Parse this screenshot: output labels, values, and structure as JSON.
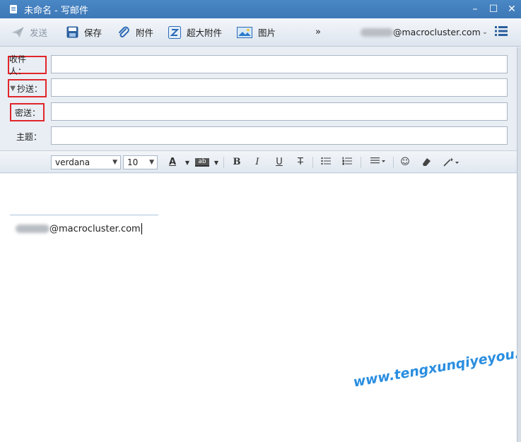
{
  "window": {
    "title": "未命名 - 写邮件",
    "controls": [
      "–",
      "☐",
      "✕"
    ]
  },
  "toolbar": {
    "send_label": "发送",
    "save_label": "保存",
    "attach_label": "附件",
    "big_attach_label": "超大附件",
    "picture_label": "图片",
    "more_label": "»",
    "account_suffix": "@macrocluster.com",
    "account_caret": "⌄"
  },
  "fields": {
    "to_label": "收件人：",
    "cc_label": "抄送：",
    "cc_toggle": "▼",
    "bcc_label": "密送：",
    "subject_label": "主题：",
    "to_value": "",
    "cc_value": "",
    "bcc_value": "",
    "subject_value": ""
  },
  "format": {
    "font": "verdana",
    "size": "10",
    "font_color_glyph": "A",
    "highlight_glyph": "ab",
    "bold": "B",
    "italic": "I",
    "underline": "U",
    "strike": "T",
    "emoji": "☺"
  },
  "editor": {
    "signature_suffix": "@macrocluster.com"
  },
  "watermark": "www.tengxunqiyeyou.com"
}
